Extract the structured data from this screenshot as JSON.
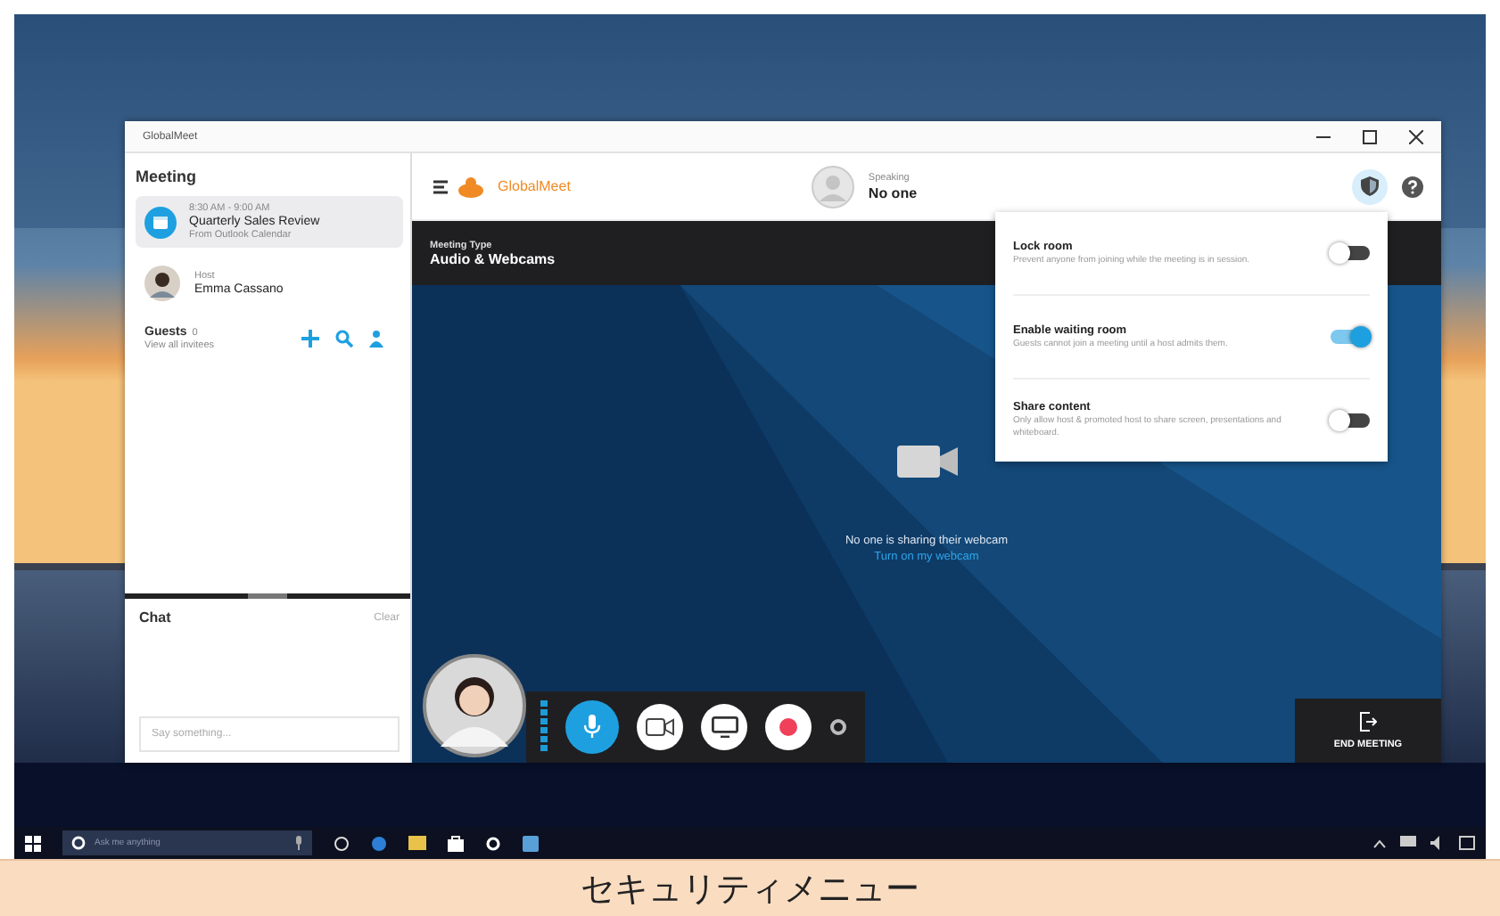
{
  "window": {
    "title": "GlobalMeet"
  },
  "sidebar": {
    "heading": "Meeting",
    "meeting": {
      "time": "8:30 AM - 9:00 AM",
      "title": "Quarterly Sales Review",
      "source": "From Outlook Calendar",
      "selected": true
    },
    "host": {
      "role": "Host",
      "name": "Emma Cassano"
    },
    "guests": {
      "label": "Guests",
      "count": "0",
      "link": "View all invitees"
    }
  },
  "chat": {
    "heading": "Chat",
    "clear": "Clear",
    "placeholder": "Say something..."
  },
  "header": {
    "logo": "GlobalMeet",
    "speaking_label": "Speaking",
    "speaker": "No one",
    "security_selected": true
  },
  "meeting_type": {
    "label": "Meeting Type",
    "value": "Audio & Webcams"
  },
  "security_menu": [
    {
      "title": "Lock room",
      "description": "Prevent anyone from joining while the meeting is in session.",
      "on": false
    },
    {
      "title": "Enable waiting room",
      "description": "Guests cannot join a meeting until a host admits them.",
      "on": true
    },
    {
      "title": "Share content",
      "description": "Only allow host & promoted host to share screen, presentations and whiteboard.",
      "on": false
    }
  ],
  "stage": {
    "message": "No one is sharing their webcam",
    "link": "Turn on my webcam"
  },
  "toolbar": [
    {
      "kind": "mic",
      "on": true
    },
    {
      "kind": "camera",
      "on": false
    },
    {
      "kind": "screen",
      "on": false
    },
    {
      "kind": "record",
      "on": false
    },
    {
      "kind": "settings",
      "on": false
    }
  ],
  "end_meeting": "END MEETING",
  "taskbar": {
    "search_placeholder": "Ask me anything"
  },
  "caption": "セキュリティメニュー"
}
